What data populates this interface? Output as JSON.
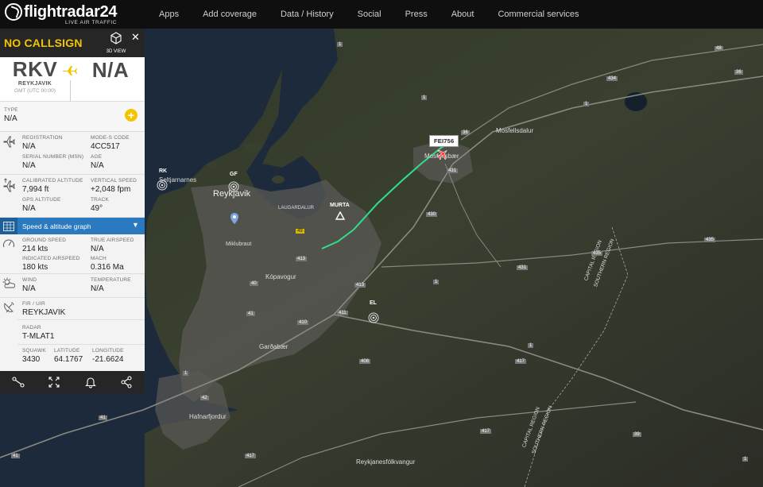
{
  "header": {
    "logo_name": "flightradar24",
    "logo_tag": "LIVE AIR TRAFFIC",
    "nav": [
      "Apps",
      "Add coverage",
      "Data / History",
      "Social",
      "Press",
      "About",
      "Commercial services"
    ]
  },
  "panel": {
    "callsign": "NO CALLSIGN",
    "view_3d_label": "3D VIEW",
    "origin": {
      "code": "RKV",
      "city": "REYKJAVIK",
      "tz": "GMT (UTC 00:00)"
    },
    "destination": {
      "code": "N/A"
    },
    "type": {
      "label": "TYPE",
      "value": "N/A"
    },
    "registration": {
      "label": "REGISTRATION",
      "value": "N/A"
    },
    "mode_s": {
      "label": "MODE-S CODE",
      "value": "4CC517"
    },
    "serial": {
      "label": "SERIAL NUMBER (MSN)",
      "value": "N/A"
    },
    "age": {
      "label": "AGE",
      "value": "N/A"
    },
    "cal_alt": {
      "label": "CALIBRATED ALTITUDE",
      "value": "7,994 ft"
    },
    "vert_speed": {
      "label": "VERTICAL SPEED",
      "value": "+2,048 fpm"
    },
    "gps_alt": {
      "label": "GPS ALTITUDE",
      "value": "N/A"
    },
    "track": {
      "label": "TRACK",
      "value": "49°"
    },
    "graph_label": "Speed & altitude graph",
    "ground_speed": {
      "label": "GROUND SPEED",
      "value": "214 kts"
    },
    "true_airspeed": {
      "label": "TRUE AIRSPEED",
      "value": "N/A"
    },
    "ind_airspeed": {
      "label": "INDICATED AIRSPEED",
      "value": "180 kts"
    },
    "mach": {
      "label": "MACH",
      "value": "0.316 Ma"
    },
    "wind": {
      "label": "WIND",
      "value": "N/A"
    },
    "temperature": {
      "label": "TEMPERATURE",
      "value": "N/A"
    },
    "fir": {
      "label": "FIR / UIR",
      "value": "REYKJAVIK"
    },
    "radar": {
      "label": "RADAR",
      "value": "T-MLAT1"
    },
    "squawk": {
      "label": "SQUAWK",
      "value": "3430"
    },
    "latitude": {
      "label": "LATITUDE",
      "value": "64.1767"
    },
    "longitude": {
      "label": "LONGITUDE",
      "value": "-21.6624"
    }
  },
  "map": {
    "flight_label": "FEI756",
    "places": {
      "mosfellsdalur": "Mosfellsdalur",
      "mosfellsbaer": "Mosfellsbær",
      "seltjarnarnes": "Seltjarnarnes",
      "reykjavik": "Reykjavik",
      "laugardalur": "LAUGARDALUR",
      "kopavogur": "Kópavogur",
      "gardabaer": "Garðabær",
      "hafnarfjordur": "Hafnarfjordur",
      "reykjanesfolkvangur": "Reykjanesfólkvangur",
      "capital_region_1": "CAPITAL REGION",
      "southern_region_1": "SOUTHERN REGION",
      "capital_region_2": "CAPITAL REGION",
      "southern_region_2": "SOUTHERN REGION",
      "miklubraut": "Miklubraut"
    },
    "markers": {
      "rk": "RK",
      "gf": "GF",
      "murta": "MURTA",
      "el": "EL"
    },
    "roads": [
      "1",
      "48",
      "36",
      "434",
      "36",
      "1",
      "431",
      "430",
      "435",
      "435",
      "431",
      "1",
      "49",
      "413",
      "40",
      "41",
      "410",
      "413",
      "411",
      "1",
      "408",
      "42",
      "41",
      "41",
      "417",
      "417",
      "417",
      "39",
      "1",
      "1",
      "1"
    ]
  },
  "colors": {
    "accent": "#f5c400",
    "nav_bg": "#0f0f0f",
    "panel_head": "#262626",
    "graph_bar": "#2b79bf",
    "track": "#2fe08a"
  }
}
